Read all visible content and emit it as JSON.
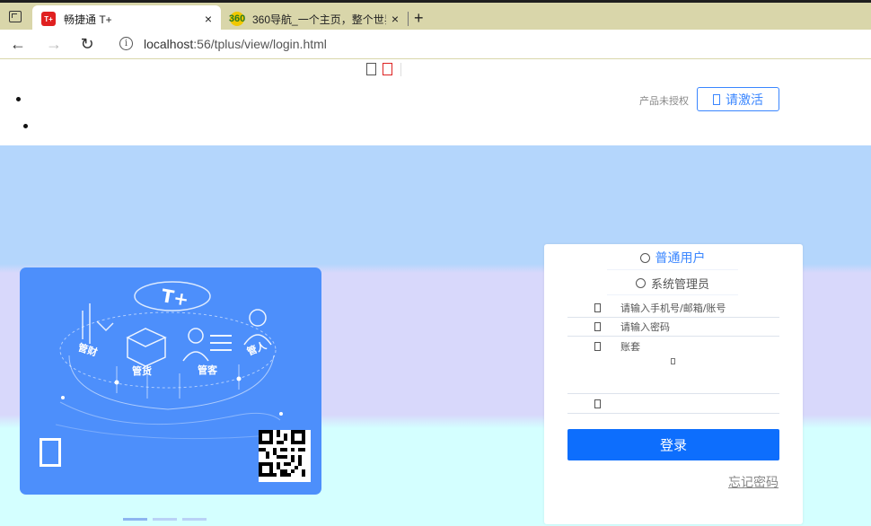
{
  "browser": {
    "tabs": [
      {
        "title": "畅捷通 T+",
        "favicon": "T+",
        "active": true
      },
      {
        "title": "360导航_一个主页，整个世界",
        "favicon": "360",
        "active": false
      }
    ],
    "close_glyph": "×",
    "new_tab_glyph": "+",
    "url_host": "localhost",
    "url_rest": ":56/tplus/view/login.html",
    "back_glyph": "←",
    "forward_glyph": "→",
    "reload_glyph": "↻",
    "info_glyph": "i"
  },
  "header": {
    "unlicensed_text": "产品未授权",
    "activate_label": "请激活"
  },
  "promo": {
    "brand": "T+",
    "labels": [
      "管财",
      "管货",
      "管客",
      "管人"
    ]
  },
  "login": {
    "role_normal": "普通用户",
    "role_admin": "系统管理员",
    "username_placeholder": "请输入手机号/邮箱/账号",
    "password_placeholder": "请输入密码",
    "account_set_label": "账套",
    "login_button": "登录",
    "forgot_password": "忘记密码"
  },
  "colors": {
    "primary": "#0d6efd",
    "accent": "#3a86ff",
    "promo_card": "#4d8ffb",
    "banner_top": "#b4d6fc",
    "banner_mid": "#d8d8fb",
    "banner_bottom": "#d4ffff"
  }
}
